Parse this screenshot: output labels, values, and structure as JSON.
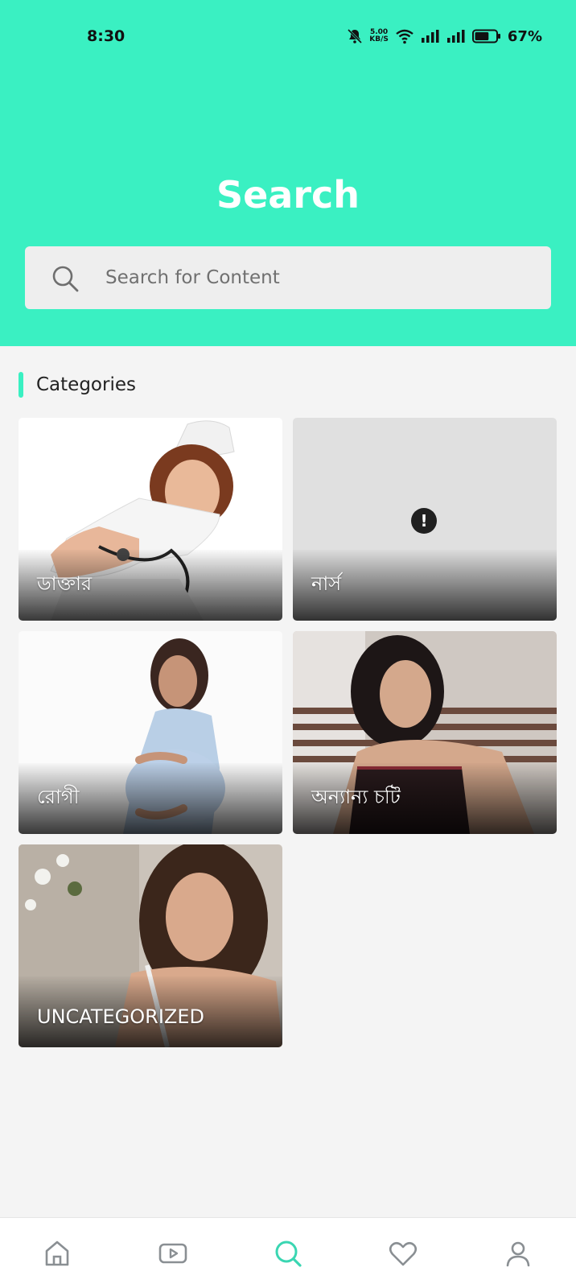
{
  "status_bar": {
    "time": "8:30",
    "net_speed_value": "5.00",
    "net_speed_unit": "KB/S",
    "battery": "67%",
    "battery_level": 0.67
  },
  "header": {
    "title": "Search",
    "background_color": "#3af0c2"
  },
  "search": {
    "placeholder": "Search for Content",
    "value": ""
  },
  "categories_section": {
    "title": "Categories",
    "items": [
      {
        "label": "ডাক্তার",
        "image": "nurse-with-stethoscope-photo"
      },
      {
        "label": "নার্স",
        "image": "image-failed-placeholder"
      },
      {
        "label": "রোগী",
        "image": "pregnant-woman-photo"
      },
      {
        "label": "অন্যান্য চটি",
        "image": "woman-portrait-photo"
      },
      {
        "label": "UNCATEGORIZED",
        "image": "woman-portrait-outdoor-photo"
      }
    ]
  },
  "bottom_nav": {
    "items": [
      {
        "icon": "home-icon",
        "active": false
      },
      {
        "icon": "video-icon",
        "active": false
      },
      {
        "icon": "search-icon",
        "active": true
      },
      {
        "icon": "heart-icon",
        "active": false
      },
      {
        "icon": "user-icon",
        "active": false
      }
    ],
    "active_color": "#3ad6b2",
    "inactive_color": "#8a8f93"
  }
}
